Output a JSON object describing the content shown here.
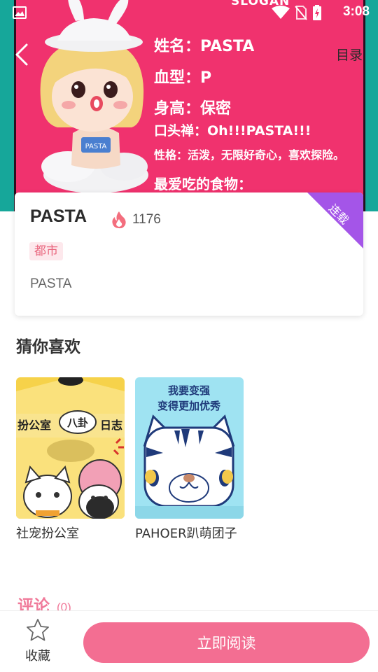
{
  "status_bar": {
    "time": "3:08",
    "icons": [
      "image-icon",
      "wifi-icon",
      "no-sim-icon",
      "battery-charging-icon"
    ]
  },
  "hero": {
    "slogan": "SLOGAN",
    "profile": {
      "name": "姓名：PASTA",
      "blood": "血型：P",
      "height": "身高：保密",
      "catchphrase": "口头禅：Oh!!!PASTA!!!",
      "personality": "性格：活泼，无限好奇心，喜欢探险。",
      "favorite_food": "最爱吃的食物："
    },
    "toc_label": "目录"
  },
  "book": {
    "title": "PASTA",
    "hot_count": "1176",
    "genre": "都市",
    "description": "PASTA",
    "status_ribbon": "连载"
  },
  "recommend": {
    "title": "猜你喜欢",
    "items": [
      {
        "title": "社宠扮公室",
        "cover_text": [
          "扮公室",
          "八卦",
          "日志"
        ]
      },
      {
        "title": "PAHOER趴萌团子",
        "cover_text": [
          "我要变强",
          "变得更加优秀"
        ]
      }
    ]
  },
  "comments": {
    "title": "评论",
    "count": "(0)"
  },
  "bottom": {
    "favorite_label": "收藏",
    "read_label": "立即阅读"
  },
  "colors": {
    "hero_bg": "#f0326e",
    "hero_side": "#16a79a",
    "ribbon": "#a455e8",
    "accent": "#f36e92",
    "tag_text": "#e9687f"
  }
}
